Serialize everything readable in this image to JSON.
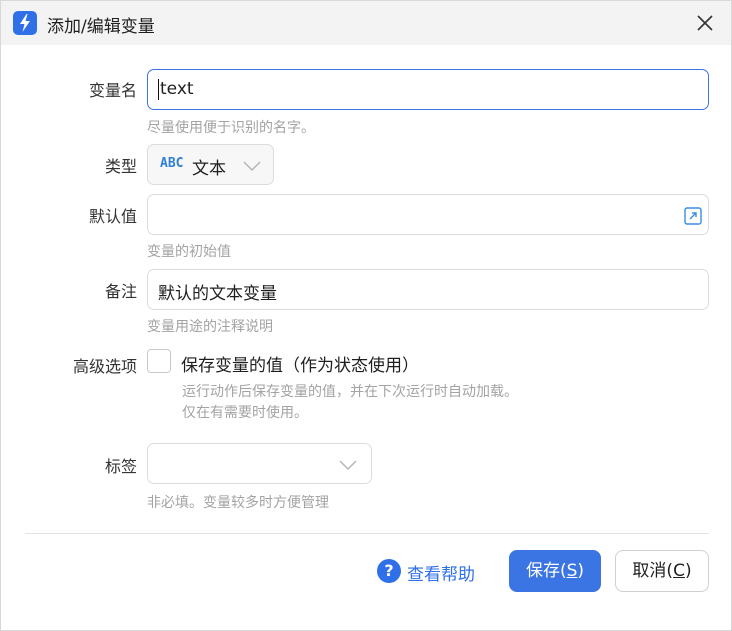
{
  "window": {
    "title": "添加/编辑变量",
    "app_icon": "lightning-app-icon",
    "close_icon": "close-icon"
  },
  "form": {
    "name": {
      "label": "变量名",
      "value": "text",
      "hint": "尽量使用便于识别的名字。"
    },
    "type": {
      "label": "类型",
      "badge": "ABC",
      "value": "文本"
    },
    "default": {
      "label": "默认值",
      "value": "",
      "hint": "变量的初始值",
      "expand_icon": "expand-icon"
    },
    "note": {
      "label": "备注",
      "value": "默认的文本变量",
      "hint": "变量用途的注释说明"
    },
    "advanced": {
      "label": "高级选项",
      "checkbox_label": "保存变量的值（作为状态使用）",
      "checked": false,
      "hint_line1": "运行动作后保存变量的值，并在下次运行时自动加载。",
      "hint_line2": "仅在有需要时使用。"
    },
    "tags": {
      "label": "标签",
      "value": "",
      "hint": "非必填。变量较多时方便管理"
    }
  },
  "footer": {
    "help_label": "查看帮助",
    "save_label_main": "保存(",
    "save_label_key": "S",
    "save_label_end": ")",
    "cancel_label_main": "取消(",
    "cancel_label_key": "C",
    "cancel_label_end": ")"
  },
  "colors": {
    "accent": "#3b74e3",
    "hint": "#a3a3a3",
    "titlebar": "#f3f3f3"
  }
}
